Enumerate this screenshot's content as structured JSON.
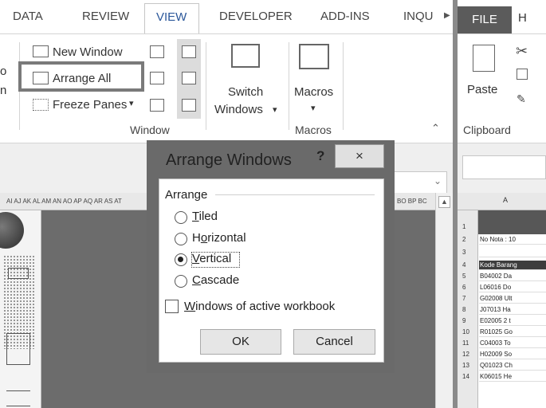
{
  "left_window": {
    "tabs": [
      {
        "label": "DATA"
      },
      {
        "label": "REVIEW"
      },
      {
        "label": "VIEW"
      },
      {
        "label": "DEVELOPER"
      },
      {
        "label": "ADD-INS"
      },
      {
        "label": "INQU"
      }
    ],
    "active_tab_index": 2,
    "ribbon": {
      "new_window": "New Window",
      "arrange_all": "Arrange All",
      "freeze_panes": "Freeze Panes",
      "freeze_panes_caret": "▾",
      "switch_windows_line1": "Switch",
      "switch_windows_line2": "Windows",
      "switch_caret": "▾",
      "macros": "Macros",
      "macros_caret": "▾",
      "group_window": "Window",
      "group_macros": "Macros",
      "partial_left_1": "o",
      "partial_left_2": "n"
    },
    "column_headers": "AI AJ AK AL AM AN AO AP AQ AR AS AT",
    "column_headers_right": "BO BP BC"
  },
  "dialog": {
    "title": "Arrange Windows",
    "help": "?",
    "close": "×",
    "group_label": "Arrange",
    "options": [
      {
        "pre": "",
        "u": "T",
        "post": "iled",
        "checked": false
      },
      {
        "pre": "H",
        "u": "o",
        "post": "rizontal",
        "checked": false
      },
      {
        "pre": "",
        "u": "V",
        "post": "ertical",
        "checked": true
      },
      {
        "pre": "",
        "u": "C",
        "post": "ascade",
        "checked": false
      }
    ],
    "checkbox": {
      "u": "W",
      "post": "indows of active workbook",
      "checked": false
    },
    "ok": "OK",
    "cancel": "Cancel"
  },
  "right_window": {
    "file_tab": "FILE",
    "next_tab_partial": "H",
    "paste": "Paste",
    "clipboard": "Clipboard",
    "col_a": "A",
    "rows": [
      {
        "num": "1",
        "cell": ""
      },
      {
        "num": "2",
        "cell": "No Nota   : 10"
      },
      {
        "num": "3",
        "cell": ""
      },
      {
        "num": "4",
        "cell": "Kode Barang"
      },
      {
        "num": "5",
        "cell": "B04002    Da"
      },
      {
        "num": "6",
        "cell": "L06016    Do"
      },
      {
        "num": "7",
        "cell": "G02008    Ult"
      },
      {
        "num": "8",
        "cell": "J07013    Ha"
      },
      {
        "num": "9",
        "cell": "E02005    2 t"
      },
      {
        "num": "10",
        "cell": "R01025    Go"
      },
      {
        "num": "11",
        "cell": "C04003    To"
      },
      {
        "num": "12",
        "cell": "H02009    So"
      },
      {
        "num": "13",
        "cell": "Q01023    Ch"
      },
      {
        "num": "14",
        "cell": "K06015    He"
      }
    ]
  }
}
